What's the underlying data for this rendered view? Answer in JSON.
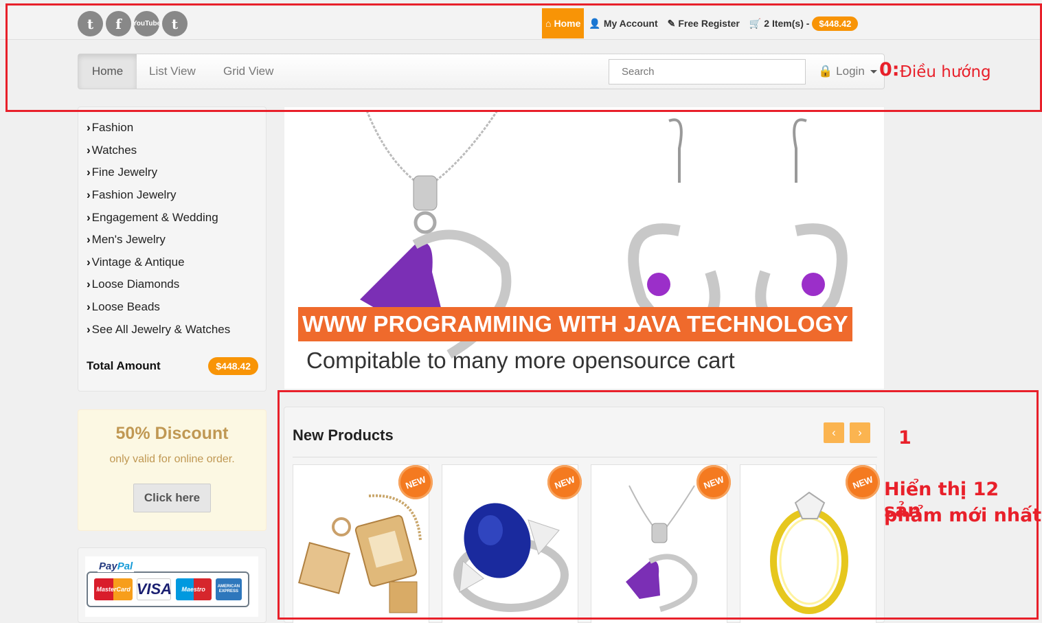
{
  "social": {
    "twitter": "t",
    "facebook": "f",
    "youtube_top": "You",
    "youtube_bottom": "Tube",
    "tumblr": "t"
  },
  "topnav": {
    "home": "Home",
    "account": "My Account",
    "register": "Free Register",
    "cart_items": "2 Item(s) -",
    "cart_total": "$448.42"
  },
  "navbar": {
    "tabs": [
      "Home",
      "List View",
      "Grid View"
    ],
    "search_placeholder": "Search",
    "login": "Login"
  },
  "annotations": {
    "nav_num": "0:",
    "nav_label": "Điều hướng",
    "products_num": "1",
    "products_line1": "Hiển thị 12 sản",
    "products_line2": "phẩm mới nhất"
  },
  "sidebar": {
    "categories": [
      "Fashion",
      "Watches",
      "Fine Jewelry",
      "Fashion Jewelry",
      "Engagement & Wedding",
      "Men's Jewelry",
      "Vintage & Antique",
      "Loose Diamonds",
      "Loose Beads",
      "See All Jewelry & Watches"
    ],
    "total_label": "Total Amount",
    "total_value": "$448.42"
  },
  "discount": {
    "heading": "50% Discount",
    "text": "only valid for online order.",
    "button": "Click here"
  },
  "payments": {
    "paypal_pay": "Pay",
    "paypal_pal": "Pal",
    "mastercard": "MasterCard",
    "visa": "VISA",
    "maestro": "Maestro",
    "amex": "AMERICAN EXPRESS"
  },
  "banner": {
    "title": "WWW PROGRAMMING WITH JAVA TECHNOLOGY",
    "subtitle": "Compitable to many more opensource cart"
  },
  "new_products": {
    "heading": "New Products",
    "prev": "‹",
    "next": "›",
    "tag": "NEW"
  },
  "colors": {
    "accent": "#f89406",
    "annotation": "#e8202a",
    "banner_title_bg": "#ef6a2c",
    "discount_text": "#c09853"
  }
}
